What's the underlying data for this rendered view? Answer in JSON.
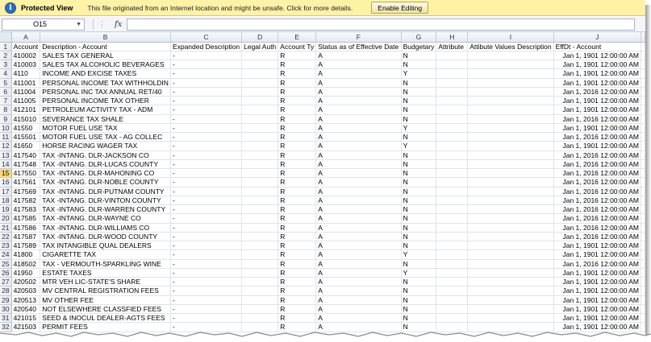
{
  "protected_view": {
    "title": "Protected View",
    "message": "This file originated from an Internet location and might be unsafe. Click for more details.",
    "button": "Enable Editing",
    "icon": "shield-info-icon"
  },
  "formula_bar": {
    "name_box": "O15",
    "fx_label": "fx",
    "formula": ""
  },
  "columns": [
    "A",
    "B",
    "C",
    "D",
    "E",
    "F",
    "G",
    "H",
    "I",
    "J"
  ],
  "selected_row": 15,
  "rows": [
    {
      "n": "1",
      "cells": [
        "Account",
        "Description - Account",
        "Expanded Description",
        "Legal Auth",
        "Account Ty",
        "Status as of Effective Date",
        "Budgetary",
        "Attribute",
        "Attibute Values Description",
        "EffDt - Account"
      ]
    },
    {
      "n": "2",
      "cells": [
        "410002",
        "SALES TAX GENERAL",
        "-",
        "",
        "R",
        "A",
        "N",
        "",
        "",
        "Jan 1, 1901 12:00:00 AM"
      ]
    },
    {
      "n": "3",
      "cells": [
        "410003",
        "SALES TAX ALCOHOLIC BEVERAGES",
        "-",
        "",
        "R",
        "A",
        "N",
        "",
        "",
        "Jan 1, 1901 12:00:00 AM"
      ]
    },
    {
      "n": "4",
      "cells": [
        "4110",
        "INCOME AND EXCISE TAXES",
        "-",
        "",
        "R",
        "A",
        "Y",
        "",
        "",
        "Jan 1, 1901 12:00:00 AM"
      ]
    },
    {
      "n": "5",
      "cells": [
        "411001",
        "PERSONAL INCOME TAX WITHHOLDIN",
        "-",
        "",
        "R",
        "A",
        "N",
        "",
        "",
        "Jan 1, 1901 12:00:00 AM"
      ]
    },
    {
      "n": "6",
      "cells": [
        "411004",
        "PERSONAL INC TAX ANNUAL RET/40",
        "-",
        "",
        "R",
        "A",
        "N",
        "",
        "",
        "Jan 1, 2016 12:00:00 AM"
      ]
    },
    {
      "n": "7",
      "cells": [
        "411005",
        "PERSONAL INCOME TAX OTHER",
        "-",
        "",
        "R",
        "A",
        "N",
        "",
        "",
        "Jan 1, 1901 12:00:00 AM"
      ]
    },
    {
      "n": "8",
      "cells": [
        "412101",
        "PETROLEUM ACTIVITY TAX - ADM",
        "-",
        "",
        "R",
        "A",
        "N",
        "",
        "",
        "Jan 1, 1901 12:00:00 AM"
      ]
    },
    {
      "n": "9",
      "cells": [
        "415010",
        "SEVERANCE TAX SHALE",
        "-",
        "",
        "R",
        "A",
        "N",
        "",
        "",
        "Jan 1, 2016 12:00:00 AM"
      ]
    },
    {
      "n": "10",
      "cells": [
        "41550",
        "MOTOR FUEL USE TAX",
        "-",
        "",
        "R",
        "A",
        "Y",
        "",
        "",
        "Jan 1, 1901 12:00:00 AM"
      ]
    },
    {
      "n": "11",
      "cells": [
        "415501",
        "MOTOR FUEL USE TAX - AG COLLEC",
        "-",
        "",
        "R",
        "A",
        "N",
        "",
        "",
        "Jan 1, 2016 12:00:00 AM"
      ]
    },
    {
      "n": "12",
      "cells": [
        "41650",
        "HORSE RACING WAGER TAX",
        "-",
        "",
        "R",
        "A",
        "Y",
        "",
        "",
        "Jan 1, 1901 12:00:00 AM"
      ]
    },
    {
      "n": "13",
      "cells": [
        "417540",
        "TAX -INTANG. DLR-JACKSON CO",
        "-",
        "",
        "R",
        "A",
        "N",
        "",
        "",
        "Jan 1, 2016 12:00:00 AM"
      ]
    },
    {
      "n": "14",
      "cells": [
        "417548",
        "TAX -INTANG. DLR-LUCAS COUNTY",
        "-",
        "",
        "R",
        "A",
        "N",
        "",
        "",
        "Jan 1, 2016 12:00:00 AM"
      ]
    },
    {
      "n": "15",
      "cells": [
        "417550",
        "TAX -INTANG. DLR-MAHONING CO",
        "-",
        "",
        "R",
        "A",
        "N",
        "",
        "",
        "Jan 1, 2016 12:00:00 AM"
      ]
    },
    {
      "n": "16",
      "cells": [
        "417561",
        "TAX -INTANG. DLR-NOBLE COUNTY",
        "-",
        "",
        "R",
        "A",
        "N",
        "",
        "",
        "Jan 1, 2016 12:00:00 AM"
      ]
    },
    {
      "n": "17",
      "cells": [
        "417569",
        "TAX -INTANG. DLR-PUTNAM COUNTY",
        "-",
        "",
        "R",
        "A",
        "N",
        "",
        "",
        "Jan 1, 2016 12:00:00 AM"
      ]
    },
    {
      "n": "18",
      "cells": [
        "417582",
        "TAX -INTANG. DLR-VINTON COUNTY",
        "-",
        "",
        "R",
        "A",
        "N",
        "",
        "",
        "Jan 1, 2016 12:00:00 AM"
      ]
    },
    {
      "n": "19",
      "cells": [
        "417583",
        "TAX -INTANG. DLR-WARREN COUNTY",
        "-",
        "",
        "R",
        "A",
        "N",
        "",
        "",
        "Jan 1, 2016 12:00:00 AM"
      ]
    },
    {
      "n": "20",
      "cells": [
        "417585",
        "TAX -INTANG. DLR-WAYNE CO",
        "-",
        "",
        "R",
        "A",
        "N",
        "",
        "",
        "Jan 1, 2016 12:00:00 AM"
      ]
    },
    {
      "n": "21",
      "cells": [
        "417586",
        "TAX -INTANG. DLR-WILLIAMS CO",
        "-",
        "",
        "R",
        "A",
        "N",
        "",
        "",
        "Jan 1, 2016 12:00:00 AM"
      ]
    },
    {
      "n": "22",
      "cells": [
        "417587",
        "TAX -INTANG. DLR-WOOD COUNTY",
        "-",
        "",
        "R",
        "A",
        "N",
        "",
        "",
        "Jan 1, 2016 12:00:00 AM"
      ]
    },
    {
      "n": "23",
      "cells": [
        "417589",
        "TAX INTANGIBLE QUAL DEALERS",
        "-",
        "",
        "R",
        "A",
        "N",
        "",
        "",
        "Jan 1, 1901 12:00:00 AM"
      ]
    },
    {
      "n": "24",
      "cells": [
        "41800",
        "CIGARETTE TAX",
        "-",
        "",
        "R",
        "A",
        "Y",
        "",
        "",
        "Jan 1, 1901 12:00:00 AM"
      ]
    },
    {
      "n": "25",
      "cells": [
        "418502",
        "TAX - VERMOUTH-SPARKLING WINE",
        "-",
        "",
        "R",
        "A",
        "N",
        "",
        "",
        "Jan 1, 2016 12:00:00 AM"
      ]
    },
    {
      "n": "26",
      "cells": [
        "41950",
        "ESTATE TAXES",
        "-",
        "",
        "R",
        "A",
        "Y",
        "",
        "",
        "Jan 1, 1901 12:00:00 AM"
      ]
    },
    {
      "n": "27",
      "cells": [
        "420502",
        "MTR VEH LIC-STATE'S SHARE",
        "-",
        "",
        "R",
        "A",
        "N",
        "",
        "",
        "Jan 1, 1901 12:00:00 AM"
      ]
    },
    {
      "n": "28",
      "cells": [
        "420503",
        "MV CENTRAL REGISTRATION FEES",
        "-",
        "",
        "R",
        "A",
        "N",
        "",
        "",
        "Jan 1, 1901 12:00:00 AM"
      ]
    },
    {
      "n": "29",
      "cells": [
        "420513",
        "MV OTHER FEE",
        "-",
        "",
        "R",
        "A",
        "N",
        "",
        "",
        "Jan 1, 1901 12:00:00 AM"
      ]
    },
    {
      "n": "30",
      "cells": [
        "420540",
        "NOT ELSEWHERE CLASSFIED FEES",
        "-",
        "",
        "R",
        "A",
        "N",
        "",
        "",
        "Jan 1, 1901 12:00:00 AM"
      ]
    },
    {
      "n": "31",
      "cells": [
        "421015",
        "SEED & INOCUL DEALER-AGTS FEES",
        "-",
        "",
        "R",
        "A",
        "N",
        "",
        "",
        "Jan 1, 1901 12:00:00 AM"
      ]
    },
    {
      "n": "32",
      "cells": [
        "421503",
        "PERMIT FEES",
        "-",
        "",
        "R",
        "A",
        "N",
        "",
        "",
        "Jan 1, 1901 12:00:00 AM"
      ]
    }
  ]
}
